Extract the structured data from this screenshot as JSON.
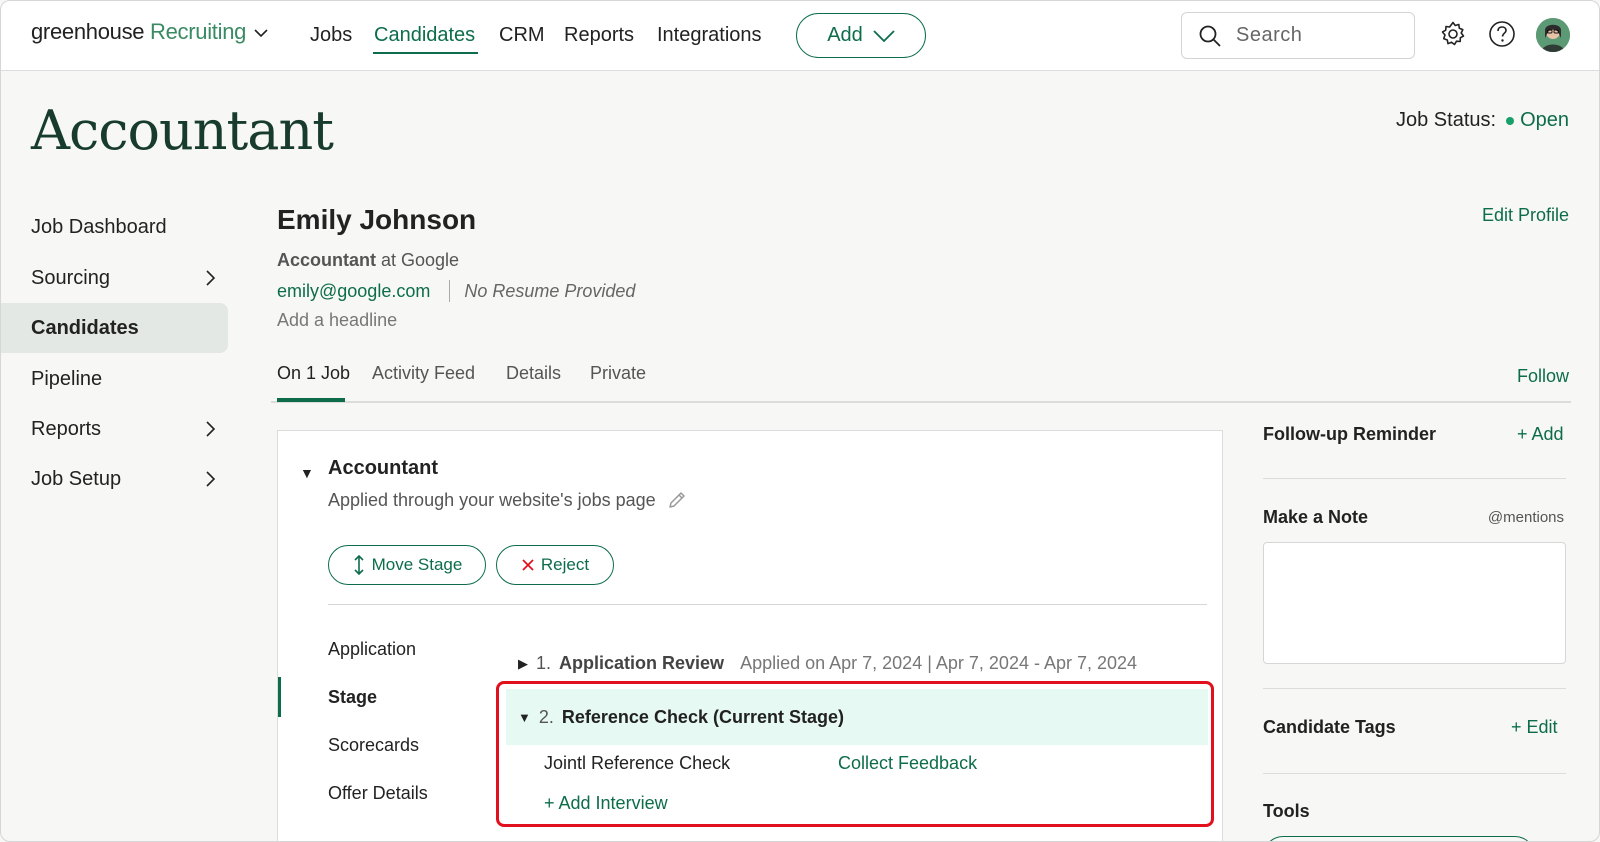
{
  "header": {
    "brand_name": "greenhouse",
    "brand_product": "Recruiting",
    "nav": [
      {
        "label": "Jobs"
      },
      {
        "label": "Candidates"
      },
      {
        "label": "CRM"
      },
      {
        "label": "Reports"
      },
      {
        "label": "Integrations"
      }
    ],
    "add_label": "Add",
    "search_placeholder": "Search",
    "accent_color": "#0d6d4b"
  },
  "page": {
    "title": "Accountant",
    "job_status_label": "Job Status:",
    "job_status_value": "Open"
  },
  "sidebar": {
    "items": [
      {
        "label": "Job Dashboard"
      },
      {
        "label": "Sourcing"
      },
      {
        "label": "Candidates"
      },
      {
        "label": "Pipeline"
      },
      {
        "label": "Reports"
      },
      {
        "label": "Job Setup"
      }
    ]
  },
  "candidate": {
    "name": "Emily Johnson",
    "role_title": "Accountant",
    "role_connector": " at ",
    "company": "Google",
    "email": "emily@google.com",
    "resume_status": "No Resume Provided",
    "headline_placeholder": "Add a headline",
    "edit_profile_label": "Edit Profile"
  },
  "tabs": {
    "items": [
      {
        "label": "On 1 Job"
      },
      {
        "label": "Activity Feed"
      },
      {
        "label": "Details"
      },
      {
        "label": "Private"
      }
    ],
    "follow_label": "Follow"
  },
  "job_card": {
    "title": "Accountant",
    "source": "Applied through your website's jobs page",
    "move_stage_label": "Move Stage",
    "reject_label": "Reject",
    "sub_nav": [
      {
        "label": "Application"
      },
      {
        "label": "Stage"
      },
      {
        "label": "Scorecards"
      },
      {
        "label": "Offer Details"
      }
    ],
    "stage1": {
      "number": "1.",
      "name": "Application Review",
      "meta": "Applied on Apr 7, 2024 | Apr 7, 2024 - Apr 7, 2024"
    },
    "stage2": {
      "number": "2.",
      "name": "Reference Check (Current Stage)",
      "interview_name": "Jointl Reference Check",
      "collect_label": "Collect Feedback",
      "add_interview_label": "+ Add Interview"
    }
  },
  "right_panel": {
    "follow_up_label": "Follow-up Reminder",
    "follow_up_action": "+ Add",
    "note_label": "Make a Note",
    "mentions_label": "@mentions",
    "tags_label": "Candidate Tags",
    "tags_action": "+ Edit",
    "tools_label": "Tools"
  }
}
